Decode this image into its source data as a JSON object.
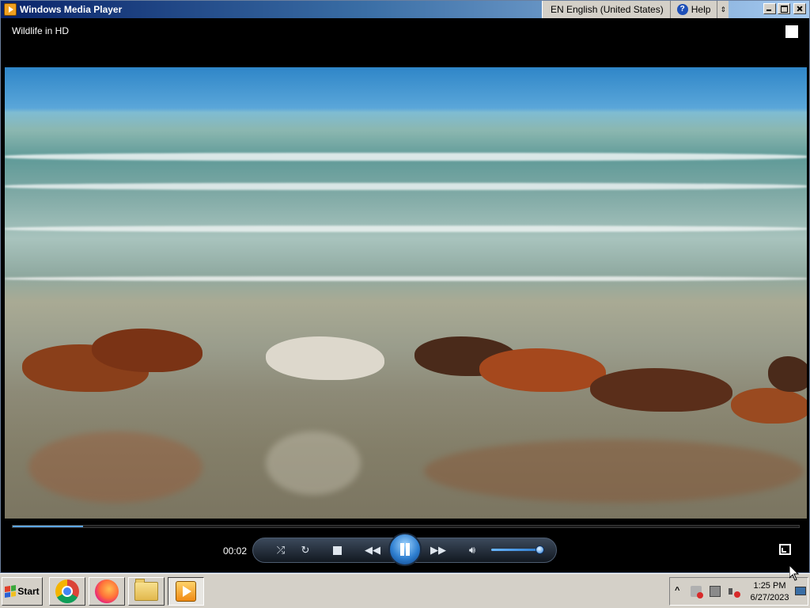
{
  "window": {
    "title": "Windows Media Player"
  },
  "langbar": {
    "language": "EN English (United States)",
    "help_label": "Help"
  },
  "player": {
    "now_playing": "Wildlife in HD",
    "elapsed": "00:02",
    "progress_fraction": 0.09,
    "volume_fraction": 0.9,
    "state": "playing"
  },
  "taskbar": {
    "start_label": "Start",
    "apps": [
      "chrome-icon",
      "firefox-icon",
      "folder-icon",
      "media-player-icon"
    ],
    "clock_time": "1:25 PM",
    "clock_date": "6/27/2023"
  }
}
